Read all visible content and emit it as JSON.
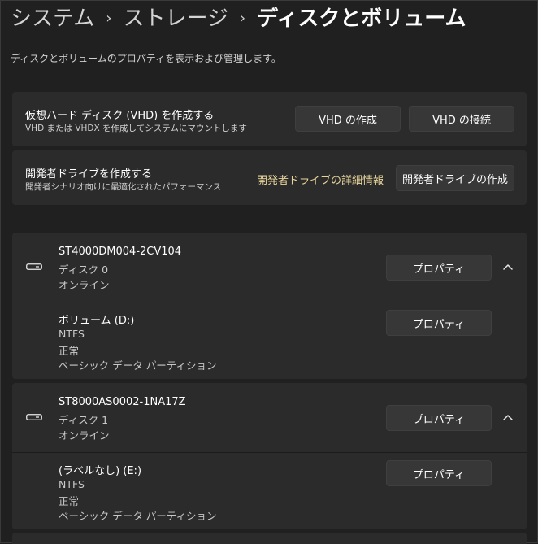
{
  "breadcrumb": {
    "items": [
      "システム",
      "ストレージ"
    ],
    "separator": "›",
    "current": "ディスクとボリューム"
  },
  "description": "ディスクとボリュームのプロパティを表示および管理します。",
  "vhd_card": {
    "title": "仮想ハード ディスク (VHD) を作成する",
    "subtitle": "VHD または VHDX を作成してシステムにマウントします",
    "create_label": "VHD の作成",
    "attach_label": "VHD の接続"
  },
  "devdrive_card": {
    "title": "開発者ドライブを作成する",
    "subtitle": "開発者シナリオ向けに最適化されたパフォーマンス",
    "link_label": "開発者ドライブの詳細情報",
    "create_label": "開発者ドライブの作成"
  },
  "disks": [
    {
      "model": "ST4000DM004-2CV104",
      "disk_label": "ディスク 0",
      "status": "オンライン",
      "properties_label": "プロパティ",
      "icon": "drive-icon",
      "expand_icon": "chevron-up-icon",
      "volume": {
        "name": "ボリューム (D:)",
        "filesystem": "NTFS",
        "health": "正常",
        "type": "ベーシック データ パーティション",
        "properties_label": "プロパティ"
      }
    },
    {
      "model": "ST8000AS0002-1NA17Z",
      "disk_label": "ディスク 1",
      "status": "オンライン",
      "properties_label": "プロパティ",
      "icon": "drive-icon",
      "expand_icon": "chevron-up-icon",
      "volume": {
        "name": "(ラベルなし) (E:)",
        "filesystem": "NTFS",
        "health": "正常",
        "type": "ベーシック データ パーティション",
        "properties_label": "プロパティ"
      }
    }
  ],
  "colors": {
    "background": "#202020",
    "card": "#2b2b2b",
    "button": "#373737",
    "link": "#e7d49a",
    "text_secondary": "#c8c8c8"
  }
}
